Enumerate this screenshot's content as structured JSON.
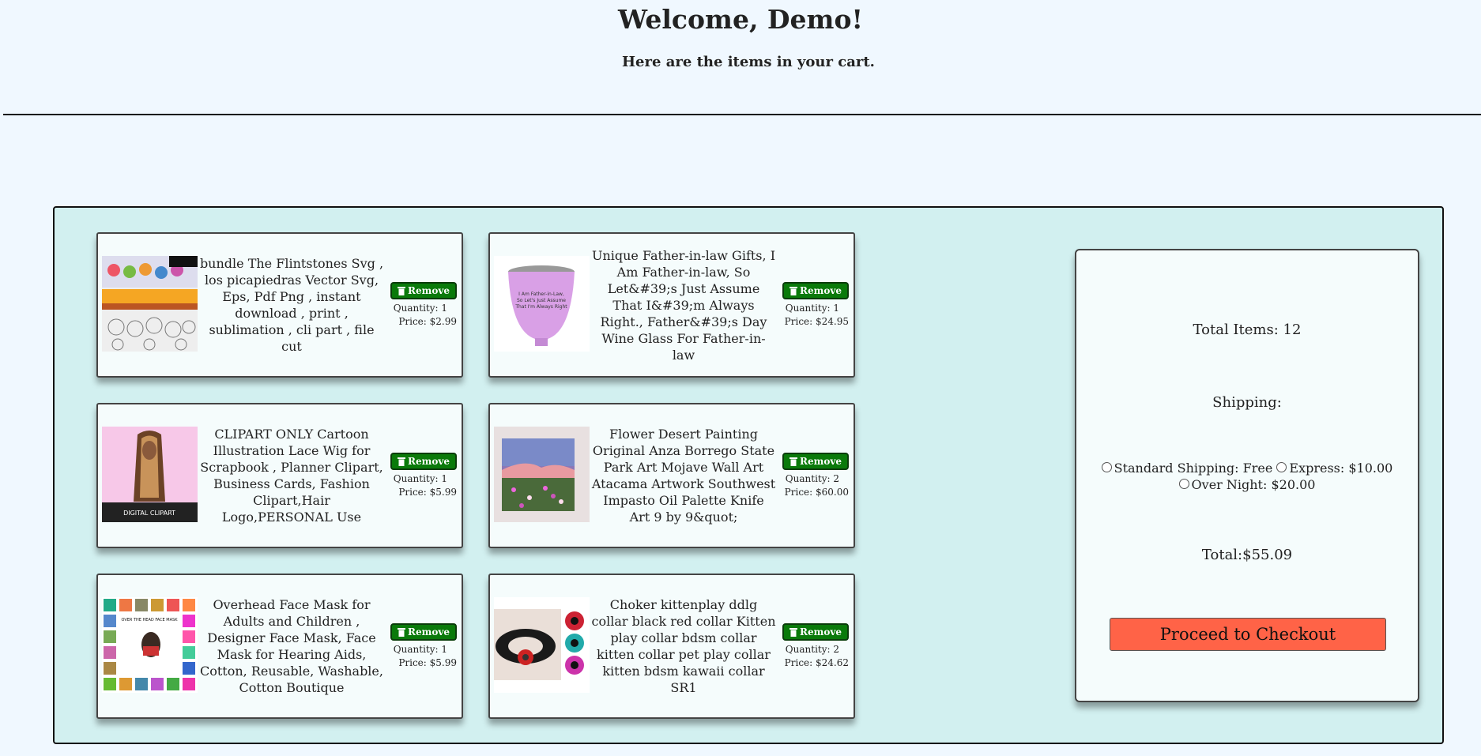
{
  "header": {
    "title": "Welcome, Demo!",
    "subtitle": "Here are the items in your cart."
  },
  "cart": {
    "remove_label": "Remove",
    "items": [
      {
        "title": "bundle The Flintstones Svg , los picapiedras Vector Svg, Eps, Pdf Png , instant download , print , sublimation , cli part , file cut",
        "quantity": "Quantity: 1",
        "price": "Price: $2.99",
        "thumb": "flintstones-clipart"
      },
      {
        "title": "Unique Father-in-law Gifts, I Am Father-in-law, So Let&#39;s Just Assume That I&#39;m Always Right., Father&#39;s Day Wine Glass For Father-in-law",
        "quantity": "Quantity: 1",
        "price": "Price: $24.95",
        "thumb": "pink-wine-tumbler",
        "thumb_text": "I Am Father-in-Law, So Let's Just Assume That I'm Always Right"
      },
      {
        "title": "CLIPART ONLY Cartoon Illustration Lace Wig for Scrapbook , Planner Clipart, Business Cards, Fashion Clipart,Hair Logo,PERSONAL Use",
        "quantity": "Quantity: 1",
        "price": "Price: $5.99",
        "thumb": "lace-wig-clipart",
        "thumb_text": "DIGITAL CLIPART"
      },
      {
        "title": "Flower Desert Painting Original Anza Borrego State Park Art Mojave Wall Art Atacama Artwork Southwest Impasto Oil Palette Knife Art 9 by 9&quot;",
        "quantity": "Quantity: 2",
        "price": "Price: $60.00",
        "thumb": "desert-painting"
      },
      {
        "title": "Overhead Face Mask for Adults and Children , Designer Face Mask, Face Mask for Hearing Aids, Cotton, Reusable, Washable, Cotton Boutique",
        "quantity": "Quantity: 1",
        "price": "Price: $5.99",
        "thumb": "face-mask-grid",
        "thumb_text": "OVER THE HEAD FACE MASK"
      },
      {
        "title": "Choker kittenplay ddlg collar black red collar Kitten play collar bdsm collar kitten collar pet play collar kitten bdsm kawaii collar SR1",
        "quantity": "Quantity: 2",
        "price": "Price: $24.62",
        "thumb": "choker-collar"
      }
    ]
  },
  "summary": {
    "total_items": "Total Items: 12",
    "shipping_label": "Shipping:",
    "options": [
      {
        "label": "Standard Shipping: Free"
      },
      {
        "label": "Express: $10.00"
      },
      {
        "label": "Over Night: $20.00"
      }
    ],
    "total": "Total:$55.09",
    "checkout_label": "Proceed to Checkout"
  },
  "colors": {
    "page_bg": "#f0f8ff",
    "cart_bg": "#d2f0f0",
    "remove_button": "#0a7a0a",
    "checkout_button": "#ff6347"
  }
}
